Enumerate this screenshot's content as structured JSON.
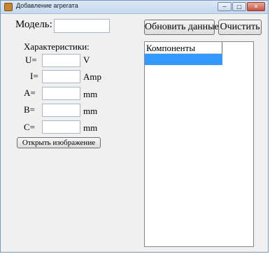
{
  "window": {
    "title": "Добавление агрегата",
    "controls": {
      "minimize": "−",
      "maximize": "□",
      "close": "✕"
    }
  },
  "model": {
    "label": "Модель:",
    "value": ""
  },
  "toolbar": {
    "refresh_label": "Обновить данные",
    "clear_label": "Очистить"
  },
  "characteristics": {
    "title": "Характеристики:",
    "fields": [
      {
        "label": "U=",
        "value": "",
        "unit": "V"
      },
      {
        "label": "I=",
        "value": "",
        "unit": "Amp"
      },
      {
        "label": "A=",
        "value": "",
        "unit": "mm"
      },
      {
        "label": "B=",
        "value": "",
        "unit": "mm"
      },
      {
        "label": "C=",
        "value": "",
        "unit": "mm"
      }
    ]
  },
  "open_image_label": "Открыть изображение",
  "components": {
    "column_header": "Компоненты",
    "rows": [
      {
        "label": ""
      }
    ]
  },
  "colors": {
    "selection": "#3399ff",
    "window_bg": "#f0f0f0"
  }
}
